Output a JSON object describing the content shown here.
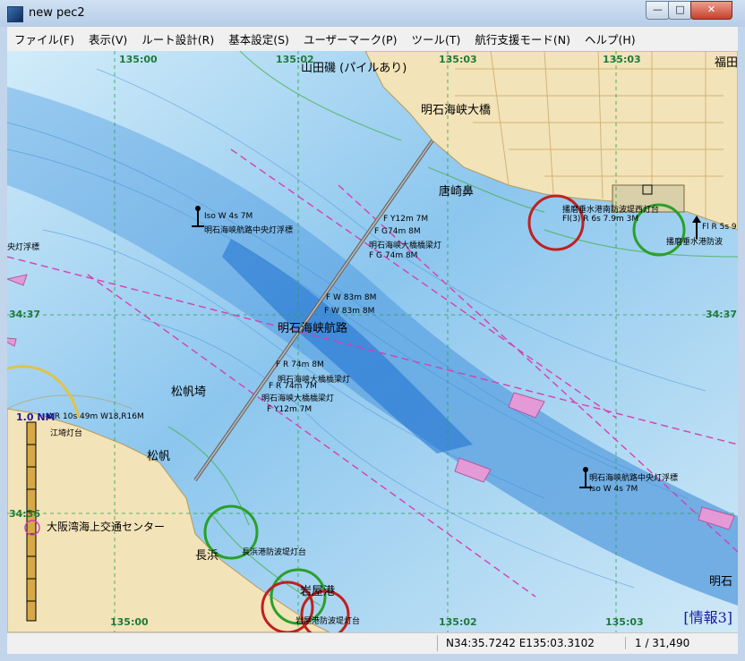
{
  "window": {
    "title": "new pec2",
    "min_glyph": "—",
    "max_glyph": "□",
    "close_glyph": "✕"
  },
  "menu": [
    "ファイル(F)",
    "表示(V)",
    "ルート設計(R)",
    "基本設定(S)",
    "ユーザーマーク(P)",
    "ツール(T)",
    "航行支援モード(N)",
    "ヘルプ(H)"
  ],
  "map": {
    "places": {
      "yamada": "山田磯 (パイルあり)",
      "bridge": "明石海峡大橋",
      "karasaki": "唐崎鼻",
      "fukuda": "福田",
      "matsuho_saki": "松帆埼",
      "matsuho": "松帆",
      "nagahama": "長浜",
      "iwaya": "岩屋港",
      "akashi": "明石",
      "center": "大阪湾海上交通センター",
      "channel": "明石海峡航路",
      "edo": "江埼灯台"
    },
    "lights": {
      "buoy_nw_char": "Iso W 4s 7M",
      "buoy_nw_name": "明石海峡航路中央灯浮標",
      "buoy_left_name": "央灯浮標",
      "bridge_n1": "F Y12m 7M",
      "bridge_n2": "F G74m 8M",
      "bridge_n3": "明石海峡大橋橋梁灯",
      "bridge_n4": "F G 74m 8M",
      "bridge_c1": "F W 83m 8M",
      "bridge_c2": "F W 83m 8M",
      "bridge_s1": "F R 74m 8M",
      "bridge_s2": "明石海峡大橋橋梁灯",
      "bridge_s3": "F R 74m 7M",
      "bridge_s4": "明石海峡大橋橋梁灯",
      "bridge_s5": "F Y12m 7M",
      "edo_char": "WR 10s 49m W18,R16M",
      "buoy_se_name": "明石海峡航路中央灯浮標",
      "buoy_se_char": "Iso W 4s 7M",
      "harima": "播磨垂水港南防波堤西灯台",
      "harima_char": "Fl(3) R 6s 7.9m 3M",
      "east_char": "Fl R 5s 9",
      "east_name": "播磨垂水港防波",
      "nagahama_light": "長浜港防波堤灯台",
      "iwaya_light": "岩屋港防波堤灯台"
    },
    "coords": {
      "t1": "135:00",
      "t2": "135:02",
      "t3": "135:03",
      "b1": "135:00",
      "b2": "135:02",
      "b3": "135:03",
      "l1": "34:37",
      "l2": "34:36",
      "r1": "34:37",
      "scale_nm": "1.0 NM"
    },
    "info_label": "[情報3]"
  },
  "status": {
    "coord": "N34:35.7242 E135:03.3102",
    "scale": "1 / 31,490"
  },
  "colors": {
    "land": "#f3e3b8",
    "shallow": "#c7e6f6",
    "deep": "#3f8fdc",
    "channel_line": "#d63fb0",
    "grid": "#2aa04a",
    "marker_red": "#c02020",
    "marker_green": "#2aa02a"
  }
}
